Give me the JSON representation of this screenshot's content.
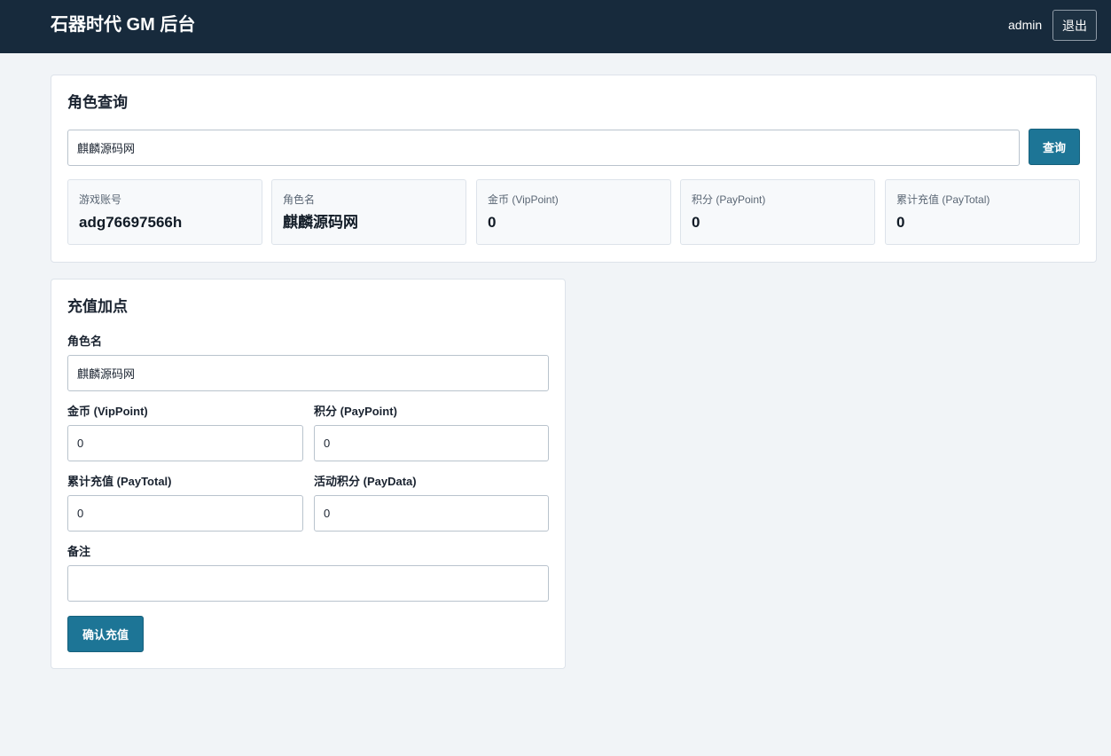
{
  "header": {
    "title": "石器时代 GM 后台",
    "user": "admin",
    "logout_label": "退出"
  },
  "query": {
    "title": "角色查询",
    "search_value": "麒麟源码网",
    "search_button": "查询",
    "info": [
      {
        "label": "游戏账号",
        "value": "adg76697566h"
      },
      {
        "label": "角色名",
        "value": "麒麟源码网"
      },
      {
        "label": "金币 (VipPoint)",
        "value": "0"
      },
      {
        "label": "积分 (PayPoint)",
        "value": "0"
      },
      {
        "label": "累计充值 (PayTotal)",
        "value": "0"
      }
    ]
  },
  "recharge": {
    "title": "充值加点",
    "role_label": "角色名",
    "role_value": "麒麟源码网",
    "vip_label": "金币 (VipPoint)",
    "vip_value": "0",
    "pay_label": "积分 (PayPoint)",
    "pay_value": "0",
    "total_label": "累计充值 (PayTotal)",
    "total_value": "0",
    "data_label": "活动积分 (PayData)",
    "data_value": "0",
    "note_label": "备注",
    "note_value": "",
    "submit_label": "确认充值"
  },
  "colors": {
    "header_bg": "#172a3c",
    "primary": "#1d7596",
    "page_bg": "#f1f4f7"
  }
}
